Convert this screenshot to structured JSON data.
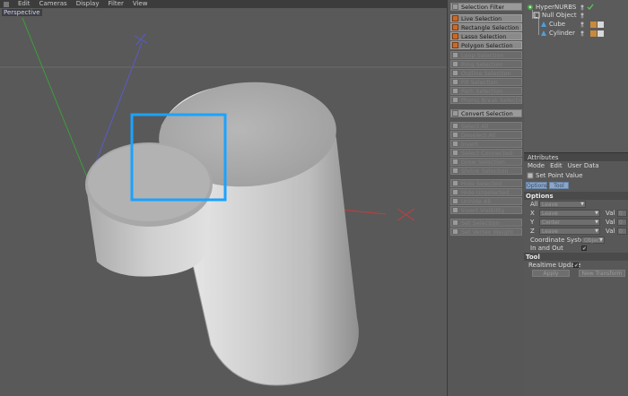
{
  "viewport": {
    "menu": [
      "Edit",
      "Cameras",
      "Display",
      "Filter",
      "View"
    ],
    "label": "Perspective"
  },
  "selection_menu": {
    "items": [
      {
        "label": "Selection Filter",
        "state": "header"
      },
      {
        "label": "Live Selection",
        "state": "enabled"
      },
      {
        "label": "Rectangle Selection",
        "state": "enabled"
      },
      {
        "label": "Lasso Selection",
        "state": "enabled"
      },
      {
        "label": "Polygon Selection",
        "state": "enabled"
      },
      {
        "label": "Loop Selection",
        "state": "disabled"
      },
      {
        "label": "Ring Selection",
        "state": "disabled"
      },
      {
        "label": "Outline Selection",
        "state": "disabled"
      },
      {
        "label": "Fill Selection",
        "state": "disabled"
      },
      {
        "label": "Path Selection",
        "state": "disabled"
      },
      {
        "label": "Phong Break Selection",
        "state": "disabled"
      },
      {
        "label": "Convert Selection",
        "state": "header"
      },
      {
        "label": "Select All",
        "state": "disabled"
      },
      {
        "label": "Deselect All",
        "state": "disabled"
      },
      {
        "label": "Invert",
        "state": "disabled"
      },
      {
        "label": "Select Connected",
        "state": "disabled"
      },
      {
        "label": "Grow Selection",
        "state": "disabled"
      },
      {
        "label": "Shrink Selection",
        "state": "disabled"
      },
      {
        "label": "Hide Selected",
        "state": "disabled"
      },
      {
        "label": "Hide Unselected",
        "state": "disabled"
      },
      {
        "label": "Unhide All",
        "state": "disabled"
      },
      {
        "label": "Invert Visibility",
        "state": "disabled"
      },
      {
        "label": "Set Selection",
        "state": "disabled"
      },
      {
        "label": "Set Vertex Weight",
        "state": "disabled"
      }
    ]
  },
  "object_manager": {
    "objects": [
      {
        "name": "HyperNURBS",
        "icon": "hypernurbs-icon"
      },
      {
        "name": "Null Object",
        "icon": "null-object-icon"
      },
      {
        "name": "Cube",
        "icon": "cube-icon"
      },
      {
        "name": "Cylinder",
        "icon": "cylinder-icon"
      }
    ]
  },
  "attributes": {
    "title": "Attributes",
    "menu": [
      "Mode",
      "Edit",
      "User Data"
    ],
    "tool_name": "Set Point Value",
    "tabs": [
      "Options",
      "Tool"
    ],
    "options_header": "Options",
    "all_label": "All",
    "all_value": "Leave",
    "axes": [
      {
        "label": "X",
        "mode": "Leave",
        "val_label": "Val",
        "val": "0 m"
      },
      {
        "label": "Y",
        "mode": "Center",
        "val_label": "Val",
        "val": "0 m"
      },
      {
        "label": "Z",
        "mode": "Leave",
        "val_label": "Val",
        "val": "0 m"
      }
    ],
    "coord_label": "Coordinate System",
    "coord_value": "Object",
    "inout_label": "In and Out",
    "tool_header": "Tool",
    "realtime_label": "Realtime Update",
    "apply_label": "Apply",
    "new_transform_label": "New Transform"
  },
  "colors": {
    "selection_rect": "#1aa3ff",
    "y_axis": "#5a5acc",
    "x_axis": "#c83c3c",
    "z_axis": "#3c9c3c",
    "menu_icon": "#c96a2c"
  }
}
